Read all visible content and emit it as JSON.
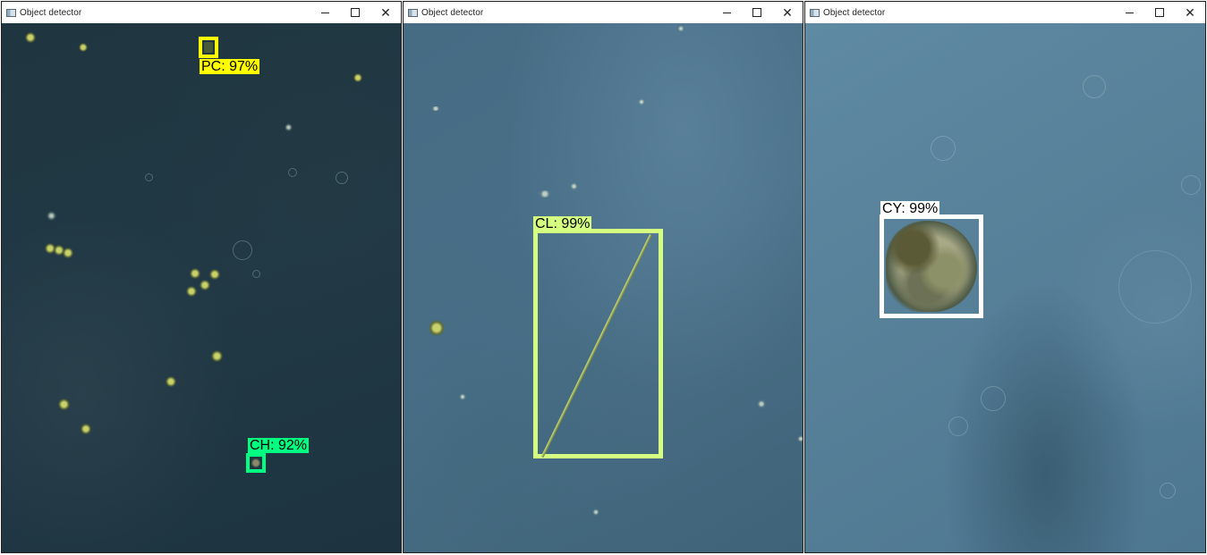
{
  "windows": [
    {
      "title": "Object detector",
      "detections": [
        {
          "label": "PC: 97%",
          "color": "#ffff00"
        },
        {
          "label": "CH: 92%",
          "color": "#00ff80"
        }
      ]
    },
    {
      "title": "Object detector",
      "detections": [
        {
          "label": "CL: 99%",
          "color": "#d4ff80"
        }
      ]
    },
    {
      "title": "Object detector",
      "detections": [
        {
          "label": "CY: 99%",
          "color": "#ffffff"
        }
      ]
    }
  ],
  "window_controls": {
    "minimize_icon": "minimize-icon",
    "maximize_icon": "maximize-icon",
    "close_icon": "close-icon",
    "close_glyph": "✕"
  }
}
